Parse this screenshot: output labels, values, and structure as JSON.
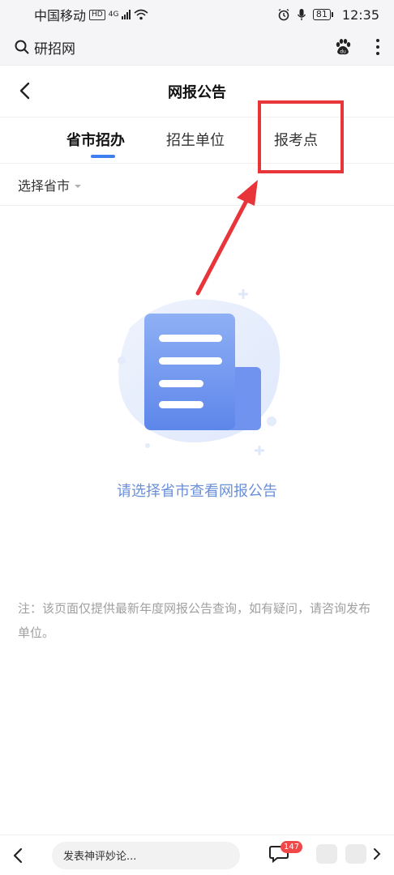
{
  "status_bar": {
    "carrier": "中国移动",
    "hd": "HD",
    "network": "4G",
    "battery": "81",
    "time": "12:35",
    "icons": [
      "hd-icon",
      "signal-icon",
      "wifi-icon",
      "alarm-icon",
      "mic-icon",
      "battery-icon"
    ]
  },
  "browser_bar": {
    "search_text": "研招网",
    "icons": [
      "search-icon",
      "baidu-paw-icon",
      "more-vertical-icon"
    ]
  },
  "header": {
    "title": "网报公告"
  },
  "tabs": [
    {
      "label": "省市招办",
      "active": true
    },
    {
      "label": "招生单位",
      "active": false
    },
    {
      "label": "报考点",
      "active": false
    }
  ],
  "filter": {
    "label": "选择省市"
  },
  "empty_state": {
    "message": "请选择省市查看网报公告"
  },
  "note": {
    "text": "注：该页面仅提供最新年度网报公告查询，如有疑问，请咨询发布单位。"
  },
  "bottom_bar": {
    "comment_placeholder": "发表神评妙论...",
    "comment_count": "147"
  },
  "colors": {
    "accent": "#3d7ef0",
    "annotation_red": "#e8353a",
    "empty_text": "#6a8fd8",
    "note_text": "#a0a0a0",
    "badge": "#f04848"
  }
}
